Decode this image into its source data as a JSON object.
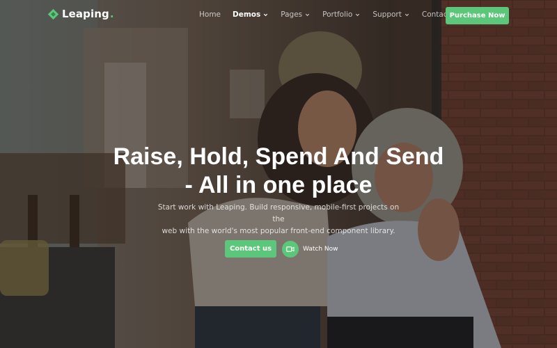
{
  "brand": {
    "name": "Leaping",
    "dot": ".",
    "accent": "#5cc77a"
  },
  "nav": {
    "items": [
      {
        "label": "Home"
      },
      {
        "label": "Demos",
        "dropdown": true,
        "active": true
      },
      {
        "label": "Pages",
        "dropdown": true
      },
      {
        "label": "Portfolio",
        "dropdown": true
      },
      {
        "label": "Support",
        "dropdown": true
      },
      {
        "label": "Contact"
      }
    ],
    "purchase_label": "Purchase Now"
  },
  "hero": {
    "headline_line1": "Raise, Hold, Spend And Send",
    "headline_line2": "- All in one place",
    "subtext_line1": "Start work with Leaping. Build responsive, mobile-first projects on the",
    "subtext_line2": "web with the world's most popular front-end component library.",
    "contact_label": "Contact us",
    "watch_label": "Watch Now",
    "watch_icon": "video-camera-icon"
  }
}
